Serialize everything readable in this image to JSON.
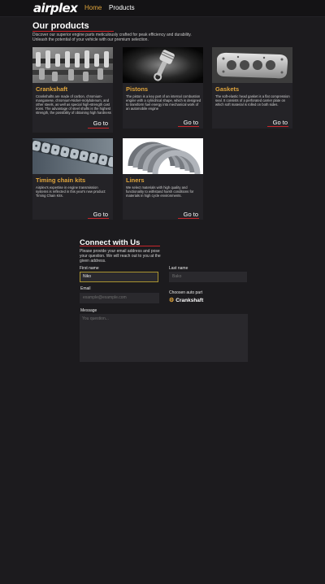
{
  "nav": {
    "logo": "airplex",
    "items": [
      {
        "label": "Home",
        "active": true
      },
      {
        "label": "Products",
        "active": false
      }
    ]
  },
  "products_section": {
    "title": "Our products",
    "subtitle": "Discover our superior engine parts meticulously crafted for peak efficiency and durability. Unleash the potential of your vehicle with our premium selection.",
    "cards": [
      {
        "title": "Crankshaft",
        "image": "crankshaft-photo",
        "description": "Crankshafts are made of carbon, chromium-manganese, chromium-Nickel-molybdenum, and other steels, as well as special high-strength cast irons. The advantage of steel shafts is the highest strength, the possibility of obtaining high hardness",
        "link": "Go to"
      },
      {
        "title": "Pistons",
        "image": "piston-photo",
        "description": "The piston is a key part of an internal combustion engine with a cylindrical shape, which is designed to transform fuel energy into mechanical work of an automobile engine",
        "link": "Go to"
      },
      {
        "title": "Gaskets",
        "image": "gasket-photo",
        "description": "The soft-elastic head gasket is a flat compression seal. It consists of a perforated carrier plate on which soft material is rolled on both sides.",
        "link": "Go to"
      },
      {
        "title": "Timing chain kits",
        "image": "timing-chain-photo",
        "description": "Airplex's expertise in engine transmission systems is reflected in this year's new product: Timing Chain Kits.",
        "link": "Go to"
      },
      {
        "title": "Liners",
        "image": "liners-photo",
        "description": "We select materials with high quality and functionality to withstand harsh conditions for materials in high cycle environments.",
        "link": "Go to"
      }
    ]
  },
  "contact": {
    "title": "Connect with Us",
    "subtitle": "Please provide your email address and pose your question. We will reach out to you at the given address.",
    "first_name": {
      "label": "First name",
      "value": "Niko"
    },
    "last_name": {
      "label": "Last name",
      "placeholder": "Bako"
    },
    "email": {
      "label": "Email",
      "placeholder": "example@example.com"
    },
    "chosen_part": {
      "label": "Choosen auto part",
      "value": "Crankshaft",
      "icon": "gear-icon"
    },
    "message": {
      "label": "Message",
      "placeholder": "You question..."
    }
  },
  "colors": {
    "accent": "#e0a53c",
    "underline": "#c8262b",
    "background": "#1c1b1e",
    "card": "#242327"
  }
}
